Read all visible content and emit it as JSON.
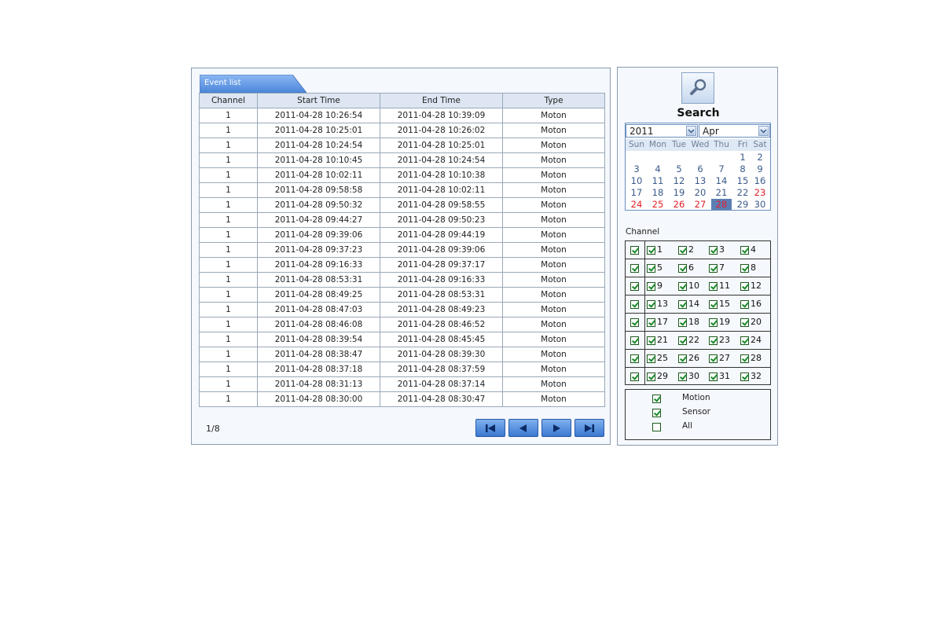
{
  "event_list": {
    "tab_label": "Event list",
    "columns": [
      "Channel",
      "Start Time",
      "End Time",
      "Type"
    ],
    "rows": [
      [
        "1",
        "2011-04-28 10:26:54",
        "2011-04-28 10:39:09",
        "Moton"
      ],
      [
        "1",
        "2011-04-28 10:25:01",
        "2011-04-28 10:26:02",
        "Moton"
      ],
      [
        "1",
        "2011-04-28 10:24:54",
        "2011-04-28 10:25:01",
        "Moton"
      ],
      [
        "1",
        "2011-04-28 10:10:45",
        "2011-04-28 10:24:54",
        "Moton"
      ],
      [
        "1",
        "2011-04-28 10:02:11",
        "2011-04-28 10:10:38",
        "Moton"
      ],
      [
        "1",
        "2011-04-28 09:58:58",
        "2011-04-28 10:02:11",
        "Moton"
      ],
      [
        "1",
        "2011-04-28 09:50:32",
        "2011-04-28 09:58:55",
        "Moton"
      ],
      [
        "1",
        "2011-04-28 09:44:27",
        "2011-04-28 09:50:23",
        "Moton"
      ],
      [
        "1",
        "2011-04-28 09:39:06",
        "2011-04-28 09:44:19",
        "Moton"
      ],
      [
        "1",
        "2011-04-28 09:37:23",
        "2011-04-28 09:39:06",
        "Moton"
      ],
      [
        "1",
        "2011-04-28 09:16:33",
        "2011-04-28 09:37:17",
        "Moton"
      ],
      [
        "1",
        "2011-04-28 08:53:31",
        "2011-04-28 09:16:33",
        "Moton"
      ],
      [
        "1",
        "2011-04-28 08:49:25",
        "2011-04-28 08:53:31",
        "Moton"
      ],
      [
        "1",
        "2011-04-28 08:47:03",
        "2011-04-28 08:49:23",
        "Moton"
      ],
      [
        "1",
        "2011-04-28 08:46:08",
        "2011-04-28 08:46:52",
        "Moton"
      ],
      [
        "1",
        "2011-04-28 08:39:54",
        "2011-04-28 08:45:45",
        "Moton"
      ],
      [
        "1",
        "2011-04-28 08:38:47",
        "2011-04-28 08:39:30",
        "Moton"
      ],
      [
        "1",
        "2011-04-28 08:37:18",
        "2011-04-28 08:37:59",
        "Moton"
      ],
      [
        "1",
        "2011-04-28 08:31:13",
        "2011-04-28 08:37:14",
        "Moton"
      ],
      [
        "1",
        "2011-04-28 08:30:00",
        "2011-04-28 08:30:47",
        "Moton"
      ]
    ],
    "page_indicator": "1/8",
    "nav_icons": [
      "first-page-icon",
      "prev-page-icon",
      "next-page-icon",
      "last-page-icon"
    ],
    "nav_color": "#3a78d0"
  },
  "search": {
    "icon": "magnifier-icon",
    "title": "Search",
    "year": "2011",
    "month": "Apr",
    "weekdays": [
      "Sun",
      "Mon",
      "Tue",
      "Wed",
      "Thu",
      "Fri",
      "Sat"
    ],
    "first_weekday": 5,
    "days_in_month": 30,
    "selected_day": 28,
    "red_days": [
      23,
      24,
      25,
      26,
      27,
      28
    ]
  },
  "channel": {
    "label": "Channel",
    "row_toggles_checked": [
      true,
      true,
      true,
      true,
      true,
      true,
      true,
      true
    ],
    "channels": [
      {
        "number": "1",
        "checked": true
      },
      {
        "number": "2",
        "checked": true
      },
      {
        "number": "3",
        "checked": true
      },
      {
        "number": "4",
        "checked": true
      },
      {
        "number": "5",
        "checked": true
      },
      {
        "number": "6",
        "checked": true
      },
      {
        "number": "7",
        "checked": true
      },
      {
        "number": "8",
        "checked": true
      },
      {
        "number": "9",
        "checked": true
      },
      {
        "number": "10",
        "checked": true
      },
      {
        "number": "11",
        "checked": true
      },
      {
        "number": "12",
        "checked": true
      },
      {
        "number": "13",
        "checked": true
      },
      {
        "number": "14",
        "checked": true
      },
      {
        "number": "15",
        "checked": true
      },
      {
        "number": "16",
        "checked": true
      },
      {
        "number": "17",
        "checked": true
      },
      {
        "number": "18",
        "checked": true
      },
      {
        "number": "19",
        "checked": true
      },
      {
        "number": "20",
        "checked": true
      },
      {
        "number": "21",
        "checked": true
      },
      {
        "number": "22",
        "checked": true
      },
      {
        "number": "23",
        "checked": true
      },
      {
        "number": "24",
        "checked": true
      },
      {
        "number": "25",
        "checked": true
      },
      {
        "number": "26",
        "checked": true
      },
      {
        "number": "27",
        "checked": true
      },
      {
        "number": "28",
        "checked": true
      },
      {
        "number": "29",
        "checked": true
      },
      {
        "number": "30",
        "checked": true
      },
      {
        "number": "31",
        "checked": true
      },
      {
        "number": "32",
        "checked": true
      }
    ]
  },
  "event_types": [
    {
      "label": "Motion",
      "checked": true
    },
    {
      "label": "Sensor",
      "checked": true
    },
    {
      "label": "All",
      "checked": false
    }
  ]
}
